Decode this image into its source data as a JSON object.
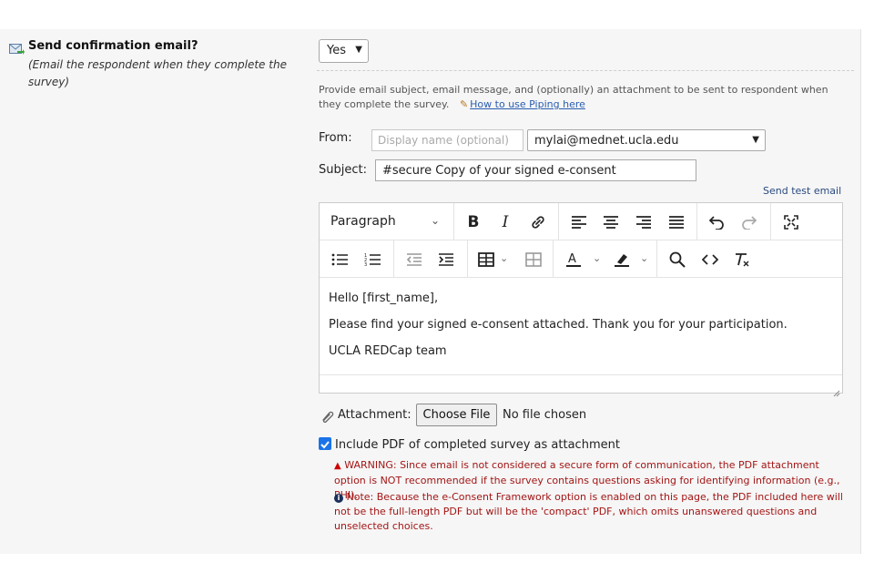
{
  "question": {
    "title": "Send confirmation email?",
    "subtitle": "(Email the respondent when they complete the survey)",
    "icon": "email-arrow-icon",
    "answer": "Yes"
  },
  "email": {
    "instructions": "Provide email subject, email message, and (optionally) an attachment to be sent to respondent when they complete the survey.",
    "piping_link": "How to use Piping here",
    "from_label": "From:",
    "display_name_placeholder": "Display name (optional)",
    "from_address": "mylai@mednet.ucla.edu",
    "subject_label": "Subject:",
    "subject_value": "#secure Copy of your signed e-consent",
    "send_test": "Send test email"
  },
  "editor": {
    "block_format": "Paragraph",
    "body": [
      "Hello [first_name],",
      "Please find your signed e-consent attached.  Thank you for your participation.",
      "UCLA REDCap team"
    ]
  },
  "attachment": {
    "label": "Attachment:",
    "button": "Choose File",
    "status": "No file chosen"
  },
  "pdf_option": {
    "checked": true,
    "label": "Include PDF of completed survey as attachment",
    "warning": "WARNING: Since email is not considered a secure form of communication, the PDF attachment option is NOT recommended if the survey contains questions asking for identifying information (e.g., PHI).",
    "note": "Note: Because the e-Consent Framework option is enabled on this page, the PDF included here will not be the full-length PDF but will be the 'compact' PDF, which omits unanswered questions and unselected choices."
  },
  "colors": {
    "link": "#2a5db0",
    "warning_text": "#a31515",
    "checkbox": "#1a73e8"
  }
}
